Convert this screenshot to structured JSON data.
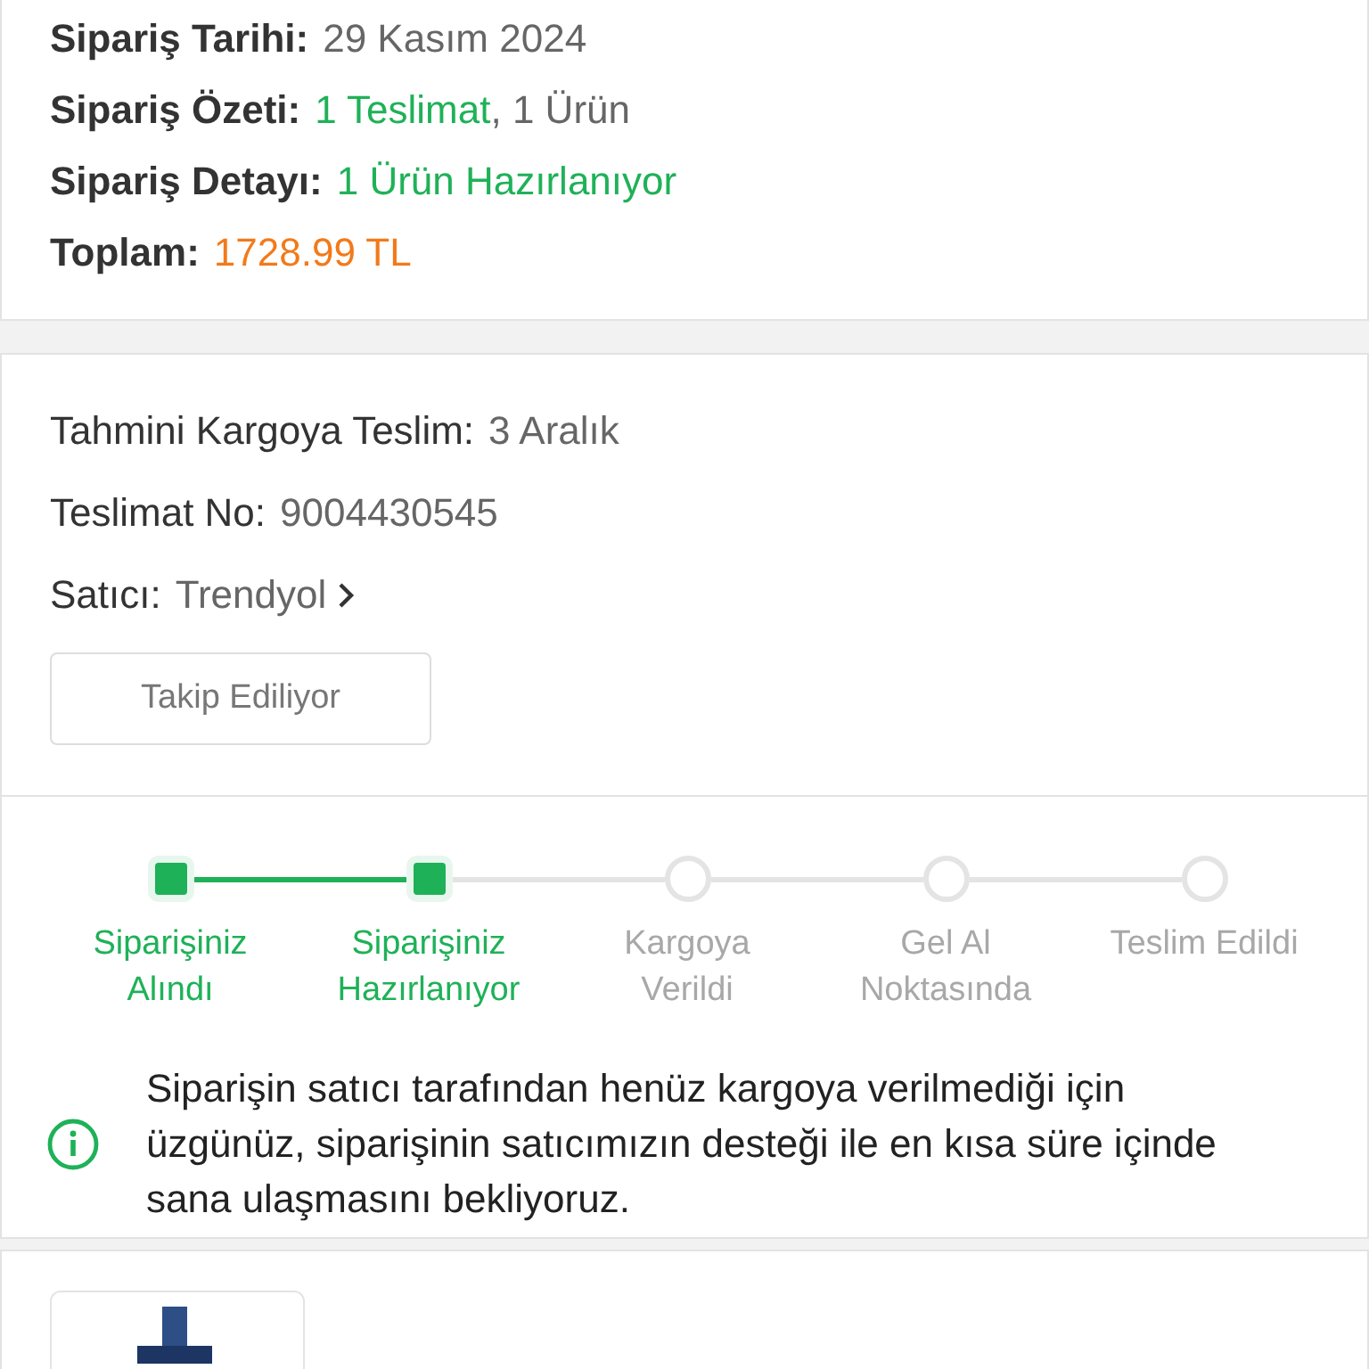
{
  "order_summary": [
    {
      "label": "Sipariş Tarihi:",
      "parts": [
        {
          "text": "29 Kasım 2024",
          "kind": "plain"
        }
      ]
    },
    {
      "label": "Sipariş Özeti:",
      "parts": [
        {
          "text": "1 Teslimat",
          "kind": "highlight"
        },
        {
          "text": ", 1 Ürün",
          "kind": "plain"
        }
      ]
    },
    {
      "label": "Sipariş Detayı:",
      "parts": [
        {
          "text": "1 Ürün Hazırlanıyor",
          "kind": "highlight"
        }
      ]
    },
    {
      "label": "Toplam:",
      "parts": [
        {
          "text": "1728.99 TL",
          "kind": "price"
        }
      ]
    }
  ],
  "delivery": {
    "rows": [
      {
        "label": "Tahmini Kargoya Teslim:",
        "value": "3 Aralık",
        "link": false
      },
      {
        "label": "Teslimat No:",
        "value": "9004430545",
        "link": false
      },
      {
        "label": "Satıcı:",
        "value": "Trendyol",
        "link": true
      }
    ],
    "follow_button": "Takip Ediliyor"
  },
  "steps": [
    {
      "label": "Siparişiniz Alındı",
      "done": true
    },
    {
      "label": "Siparişiniz Hazırlanıyor",
      "done": true
    },
    {
      "label": "Kargoya Verildi",
      "done": false
    },
    {
      "label": "Gel Al Noktasında",
      "done": false
    },
    {
      "label": "Teslim Edildi",
      "done": false
    }
  ],
  "notice": "Siparişin satıcı tarafından henüz kargoya verilmediği için üzgünüz, siparişinin satıcımızın desteği ile en kısa süre içinde sana ulaşmasını bekliyoruz."
}
